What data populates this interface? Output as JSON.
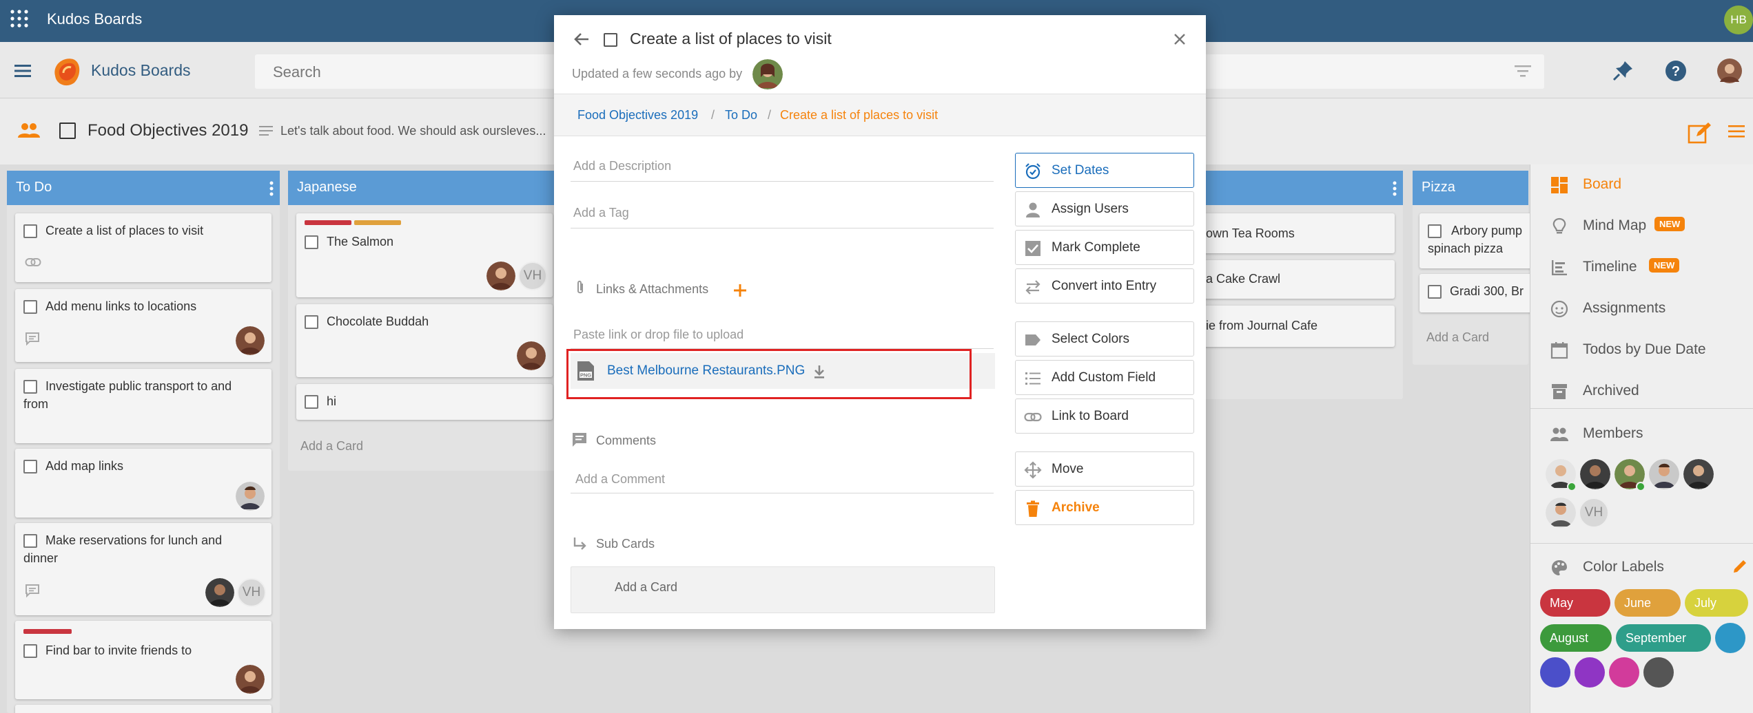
{
  "app": {
    "title": "Kudos Boards",
    "user_initials": "HB"
  },
  "header": {
    "brand": "Kudos Boards",
    "search_placeholder": "Search"
  },
  "board": {
    "title": "Food Objectives 2019",
    "description": "Let's talk about food. We should ask oursleves...",
    "columns": [
      {
        "title": "To Do",
        "color": "#5b9bd5",
        "cards": [
          {
            "title": "Create a list of places to visit"
          },
          {
            "title": "Add menu links to locations"
          },
          {
            "title": "Investigate public transport to and from"
          },
          {
            "title": "Add map links"
          },
          {
            "title": "Make reservations for lunch and dinner",
            "assignee_initials": "VH"
          },
          {
            "title": "Find bar to invite friends to"
          }
        ]
      },
      {
        "title": "Japanese",
        "color": "#5b9bd5",
        "cards": [
          {
            "title": "The Salmon",
            "assignee_initials": "VH"
          },
          {
            "title": "Chocolate Buddah"
          },
          {
            "title": "hi"
          }
        ],
        "add_card": "Add a Card"
      },
      {
        "title": "",
        "color": "#5b9bd5",
        "cards": [
          {
            "title": "own Tea Rooms"
          },
          {
            "title": "a Cake Crawl"
          },
          {
            "title": "ie from Journal Cafe"
          }
        ]
      },
      {
        "title": "Pizza",
        "color": "#5b9bd5",
        "cards": [
          {
            "title": "Arbory pump spinach pizza"
          },
          {
            "title": "Gradi 300, Br"
          }
        ],
        "add_card": "Add a Card"
      }
    ]
  },
  "right_panel": {
    "items": [
      {
        "label": "Board",
        "active": true
      },
      {
        "label": "Mind Map",
        "badge": "NEW"
      },
      {
        "label": "Timeline",
        "badge": "NEW"
      },
      {
        "label": "Assignments"
      },
      {
        "label": "Todos by Due Date"
      },
      {
        "label": "Archived"
      }
    ],
    "members_label": "Members",
    "member_initials": "VH",
    "color_labels_title": "Color Labels",
    "color_labels": [
      {
        "name": "May",
        "color": "#c9353f"
      },
      {
        "name": "June",
        "color": "#e0a13c"
      },
      {
        "name": "July",
        "color": "#d7d23d"
      },
      {
        "name": "August",
        "color": "#3c9a3c"
      },
      {
        "name": "September",
        "color": "#2e9e8a"
      }
    ],
    "color_dots": [
      "#2d97c7",
      "#4b4fc9",
      "#8f35c4",
      "#d23b9b",
      "#555555"
    ]
  },
  "modal": {
    "title": "Create a list of places to visit",
    "updated": "Updated a few seconds ago by",
    "breadcrumb": [
      "Food Objectives 2019",
      "To Do",
      "Create a list of places to visit"
    ],
    "description_placeholder": "Add a Description",
    "tag_placeholder": "Add a Tag",
    "links_label": "Links & Attachments",
    "paste_placeholder": "Paste link or drop file to upload",
    "attachment": {
      "name": "Best Melbourne Restaurants.PNG",
      "type": "PNG"
    },
    "comments_label": "Comments",
    "comment_placeholder": "Add a Comment",
    "subcards_label": "Sub Cards",
    "add_card": "Add a Card",
    "actions": [
      {
        "label": "Set Dates",
        "icon": "alarm-clock-icon"
      },
      {
        "label": "Assign Users",
        "icon": "person-icon"
      },
      {
        "label": "Mark Complete",
        "icon": "checkbox-icon"
      },
      {
        "label": "Convert into Entry",
        "icon": "swap-icon"
      },
      {
        "label": "Select Colors",
        "icon": "label-icon"
      },
      {
        "label": "Add Custom Field",
        "icon": "list-icon"
      },
      {
        "label": "Link to Board",
        "icon": "link-icon"
      },
      {
        "label": "Move",
        "icon": "move-icon"
      },
      {
        "label": "Archive",
        "icon": "trash-icon"
      }
    ]
  },
  "colors": {
    "accent": "#f5830c",
    "primary": "#325c80",
    "column_header": "#5b9bd5",
    "link": "#1a6dbb",
    "highlight": "#e02222"
  }
}
